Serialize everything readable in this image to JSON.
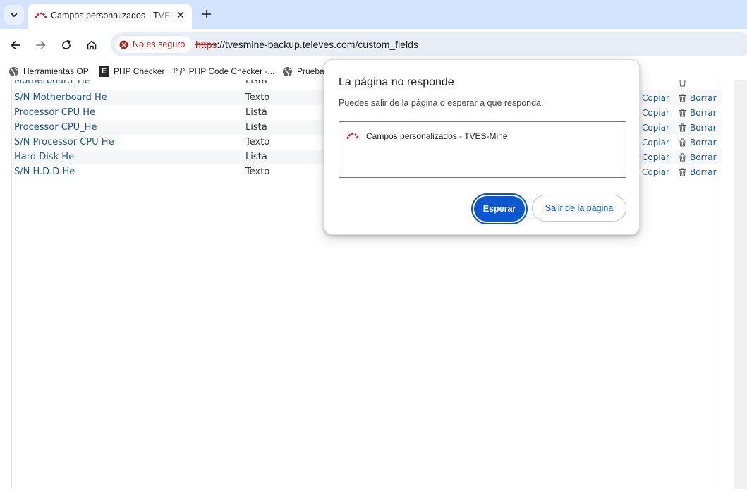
{
  "browser": {
    "tab": {
      "title": "Campos personalizados - TVES-Mine"
    },
    "security_chip": "No es seguro",
    "url": {
      "scheme": "https",
      "rest": "://tvesmine-backup.televes.com/custom_fields"
    },
    "bookmarks": [
      {
        "label": "Herramientas OP",
        "icon": "globe-icon"
      },
      {
        "label": "PHP Checker",
        "icon": "e-box-icon"
      },
      {
        "label": "PHP Code Checker -...",
        "icon": "php-icon"
      },
      {
        "label": "Prueba",
        "icon": "globe-icon"
      }
    ]
  },
  "table": {
    "partial_row": {
      "name": "Motherboard_He",
      "type": "Lista"
    },
    "rows": [
      {
        "name": "S/N Motherboard He",
        "type": "Texto"
      },
      {
        "name": "Processor CPU He",
        "type": "Lista"
      },
      {
        "name": "Processor CPU_He",
        "type": "Lista"
      },
      {
        "name": "S/N Processor CPU He",
        "type": "Texto"
      },
      {
        "name": "Hard Disk He",
        "type": "Lista"
      },
      {
        "name": "S/N H.D.D He",
        "type": "Texto"
      }
    ],
    "copy_label": "Copiar",
    "delete_label": "Borrar"
  },
  "dialog": {
    "title": "La página no responde",
    "message": "Puedes salir de la página o esperar a que responda.",
    "page_item": "Campos personalizados - TVES-Mine",
    "wait_label": "Esperar",
    "exit_label": "Salir de la página"
  },
  "colors": {
    "accent": "#0b57d0",
    "link": "#1d5a86",
    "warning": "#b3261e",
    "tabstrip": "#d3e3fd"
  }
}
